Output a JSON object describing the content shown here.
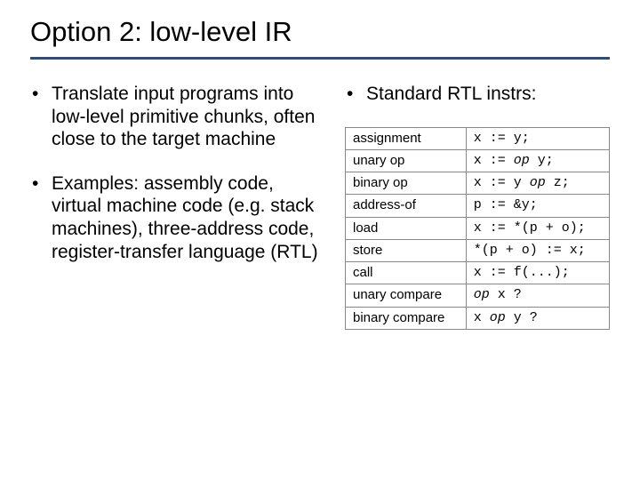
{
  "title": "Option 2: low-level IR",
  "leftBullets": [
    "Translate input programs into low-level primitive chunks, often close to the target machine",
    "Examples: assembly code, virtual machine code (e.g. stack machines), three-address code, register-transfer language (RTL)"
  ],
  "rightBullet": "Standard RTL instrs:",
  "table": [
    {
      "name": "assignment",
      "code": "x := y;"
    },
    {
      "name": "unary op",
      "code": "x := <i>op</i> y;"
    },
    {
      "name": "binary op",
      "code": "x := y <i>op</i> z;"
    },
    {
      "name": "address-of",
      "code": "p := &y;"
    },
    {
      "name": "load",
      "code": "x := *(p + o);"
    },
    {
      "name": "store",
      "code": "*(p + o) := x;"
    },
    {
      "name": "call",
      "code": "x := f(...);"
    },
    {
      "name": "unary compare",
      "code": "<i>op</i> x ?"
    },
    {
      "name": "binary compare",
      "code": "x <i>op</i> y ?"
    }
  ]
}
